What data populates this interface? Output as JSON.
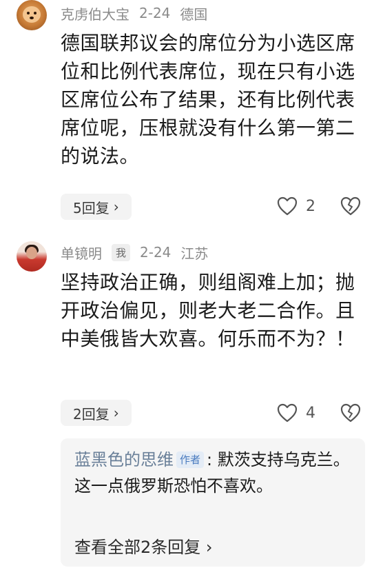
{
  "comments": [
    {
      "user": "克虏伯大宝",
      "date": "2-24",
      "location": "德国",
      "text": "德国联邦议会的席位分为小选区席位和比例代表席位，现在只有小选区席位公布了结果，还有比例代表席位呢，压根就没有什么第一第二的说法。",
      "replies_label": "5回复",
      "likes": "2"
    },
    {
      "user": "单镜明",
      "badge": "我",
      "date": "2-24",
      "location": "江苏",
      "text": "坚持政治正确，则组阁难上加；抛开政治偏见，则老大老二合作。且中美俄皆大欢喜。何乐而不为？！",
      "replies_label": "2回复",
      "likes": "4"
    }
  ],
  "sub_reply": {
    "author": "蓝黑色的思维",
    "author_badge": "作者",
    "separator": ":",
    "text": "默茨支持乌克兰。这一点俄罗斯恐怕不喜欢。",
    "view_all_label": "查看全部2条回复"
  },
  "icons": {
    "like": "heart-outline-icon",
    "dislike": "broken-heart-icon",
    "chevron": "chevron-right-icon"
  },
  "colors": {
    "meta_text": "#8a8a8a",
    "author_link": "#6a8099",
    "author_badge_bg": "#e4ecf6",
    "author_badge_text": "#4a7bbf",
    "pill_bg": "#f3f3f3"
  }
}
